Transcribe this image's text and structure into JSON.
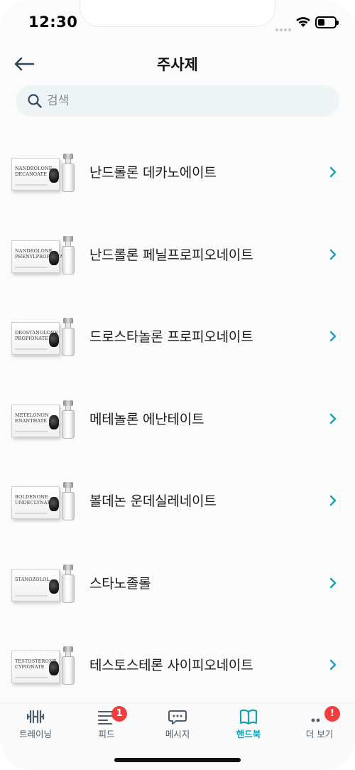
{
  "status_bar": {
    "time": "12:30"
  },
  "header": {
    "title": "주사제"
  },
  "search": {
    "placeholder": "검색"
  },
  "items": [
    {
      "label": "난드롤론 데카노에이트",
      "box_label": "NANDROLONE\nDECANOATE"
    },
    {
      "label": "난드롤론 페닐프로피오네이트",
      "box_label": "NANDROLONE\nPHENYLPROPIONATE"
    },
    {
      "label": "드로스타놀론 프로피오네이트",
      "box_label": "DROSTANOLONE\nPROPIONATE"
    },
    {
      "label": "메테놀론 에난테이트",
      "box_label": "METELONON\nENANTHATE"
    },
    {
      "label": "볼데논 운데실레네이트",
      "box_label": "BOLDENONE\nUNDECLYNATE"
    },
    {
      "label": "스타노졸롤",
      "box_label": "STANOZOLOL"
    },
    {
      "label": "테스토스테론 사이피오네이트",
      "box_label": "TESTOSTERONE\nCYPIONATE"
    }
  ],
  "tabbar": {
    "tabs": [
      {
        "label": "트레이닝",
        "icon": "dumbbell-icon"
      },
      {
        "label": "피드",
        "icon": "feed-list-icon",
        "badge": "1"
      },
      {
        "label": "메시지",
        "icon": "chat-bubble-icon"
      },
      {
        "label": "핸드북",
        "icon": "open-book-icon",
        "active": true
      },
      {
        "label": "더 보기",
        "icon": "more-dots-icon",
        "badge": "!"
      }
    ]
  },
  "colors": {
    "accent": "#1aa2b0",
    "badge": "#f03e3e",
    "search_bg": "#eff4f6"
  }
}
